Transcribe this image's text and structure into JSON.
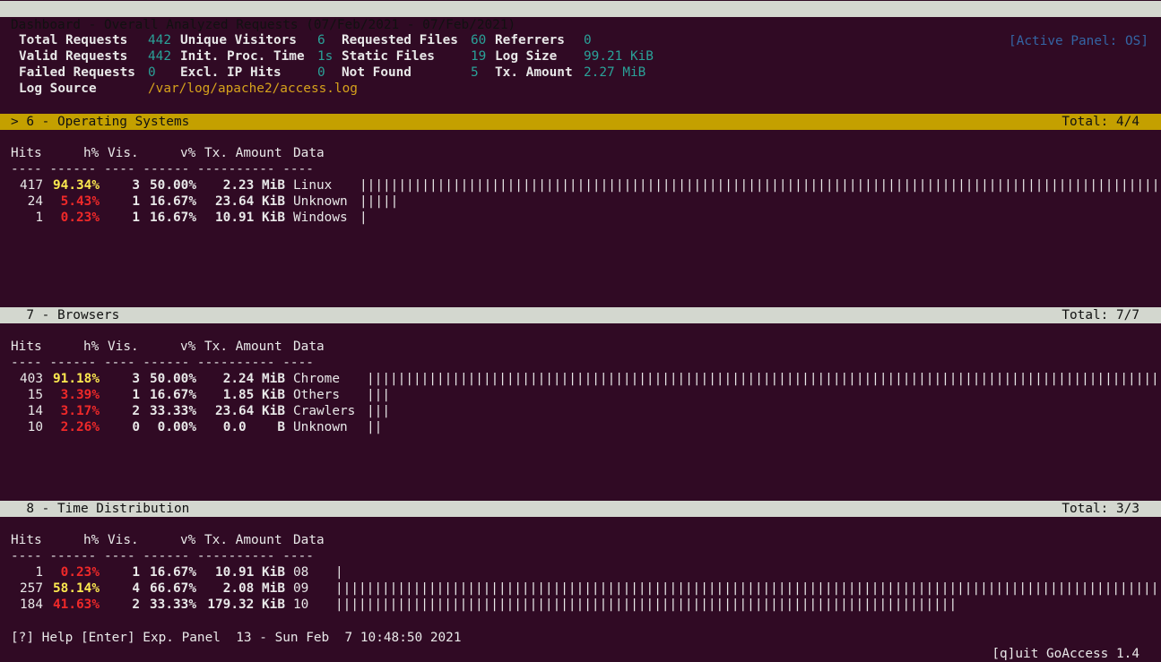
{
  "title": "Dashboard - Overall Analyzed Requests (07/Feb/2021 - 07/Feb/2021)",
  "active_panel": "[Active Panel: OS]",
  "overview": {
    "total_requests_label": "Total Requests",
    "total_requests": "442",
    "unique_visitors_label": "Unique Visitors",
    "unique_visitors": "6",
    "requested_files_label": "Requested Files",
    "requested_files": "60",
    "referrers_label": "Referrers",
    "referrers": "0",
    "valid_requests_label": "Valid Requests",
    "valid_requests": "442",
    "init_proc_time_label": "Init. Proc. Time",
    "init_proc_time": "1s",
    "static_files_label": "Static Files",
    "static_files": "19",
    "log_size_label": "Log Size",
    "log_size": "99.21 KiB",
    "failed_requests_label": "Failed Requests",
    "failed_requests": "0",
    "excl_ip_hits_label": "Excl. IP Hits",
    "excl_ip_hits": "0",
    "not_found_label": "Not Found",
    "not_found": "5",
    "tx_amount_label": "Tx. Amount",
    "tx_amount": "2.27 MiB",
    "log_source_label": "Log Source",
    "log_source": "/var/log/apache2/access.log"
  },
  "columns": {
    "hits": "Hits",
    "hpct": "h%",
    "vis": "Vis.",
    "vpct": "v%",
    "tx": "Tx. Amount",
    "data": "Data",
    "sep": "---- ------ ---- ------ ---------- ----"
  },
  "panels": [
    {
      "title": "> 6 - Operating Systems",
      "total": "Total: 4/4",
      "rows": [
        {
          "hits": "417",
          "hpct": "94.34%",
          "vis": "3",
          "vpct": "50.00%",
          "tx": "2.23 MiB",
          "data": "Linux",
          "bars": "||||||||||||||||||||||||||||||||||||||||||||||||||||||||||||||||||||||||||||||||||||||||||||||||||||||||||||||||"
        },
        {
          "hits": "24",
          "hpct": "5.43%",
          "vis": "1",
          "vpct": "16.67%",
          "tx": "23.64 KiB",
          "data": "Unknown",
          "bars": "|||||"
        },
        {
          "hits": "1",
          "hpct": "0.23%",
          "vis": "1",
          "vpct": "16.67%",
          "tx": "10.91 KiB",
          "data": "Windows",
          "bars": "|"
        }
      ]
    },
    {
      "title": "  7 - Browsers",
      "total": "Total: 7/7",
      "rows": [
        {
          "hits": "403",
          "hpct": "91.18%",
          "vis": "3",
          "vpct": "50.00%",
          "tx": "2.24 MiB",
          "data": "Chrome",
          "bars": "|||||||||||||||||||||||||||||||||||||||||||||||||||||||||||||||||||||||||||||||||||||||||||||||||||||||||||||||"
        },
        {
          "hits": "15",
          "hpct": "3.39%",
          "vis": "1",
          "vpct": "16.67%",
          "tx": "1.85 KiB",
          "data": "Others",
          "bars": "|||"
        },
        {
          "hits": "14",
          "hpct": "3.17%",
          "vis": "2",
          "vpct": "33.33%",
          "tx": "23.64 KiB",
          "data": "Crawlers",
          "bars": "|||"
        },
        {
          "hits": "10",
          "hpct": "2.26%",
          "vis": "0",
          "vpct": "0.00%",
          "tx": "0.0    B",
          "data": "Unknown",
          "bars": "||"
        }
      ]
    },
    {
      "title": "  8 - Time Distribution",
      "total": "Total: 3/3",
      "rows": [
        {
          "hits": "1",
          "hpct": "0.23%",
          "vis": "1",
          "vpct": "16.67%",
          "tx": "10.91 KiB",
          "data": "08",
          "bars": "|"
        },
        {
          "hits": "257",
          "hpct": "58.14%",
          "vis": "4",
          "vpct": "66.67%",
          "tx": "2.08 MiB",
          "data": "09",
          "bars": "||||||||||||||||||||||||||||||||||||||||||||||||||||||||||||||||||||||||||||||||||||||||||||||||||||||||||||||||||"
        },
        {
          "hits": "184",
          "hpct": "41.63%",
          "vis": "2",
          "vpct": "33.33%",
          "tx": "179.32 KiB",
          "data": "10",
          "bars": "||||||||||||||||||||||||||||||||||||||||||||||||||||||||||||||||||||||||||||||||"
        }
      ]
    }
  ],
  "footer": {
    "help": "[?] Help [Enter] Exp. Panel  13 - Sun Feb  7 10:48:50 2021",
    "quit": "[q]uit GoAccess 1.4"
  }
}
